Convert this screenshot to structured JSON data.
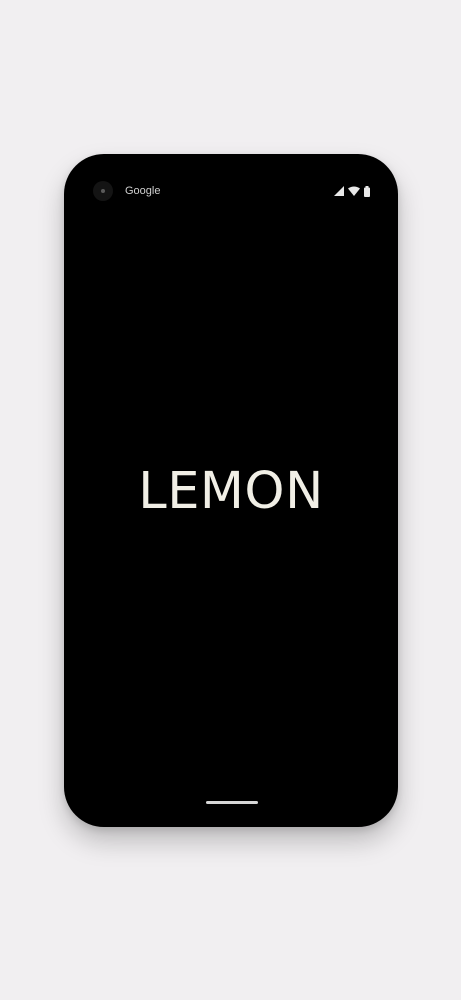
{
  "status_bar": {
    "carrier": "Google",
    "icons": [
      "signal-icon",
      "wifi-icon",
      "battery-icon"
    ]
  },
  "splash": {
    "title": "LEMON"
  },
  "colors": {
    "page_background": "#f1eff1",
    "screen_background": "#000000",
    "title_color": "#f1efe6"
  }
}
